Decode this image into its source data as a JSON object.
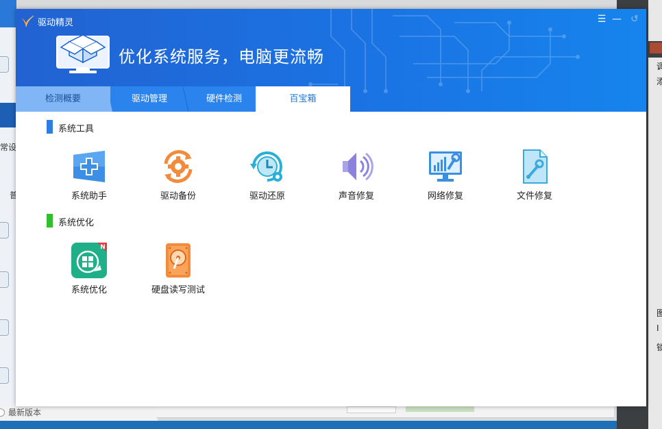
{
  "app": {
    "title": "驱动精灵",
    "banner_text": "优化系统服务，电脑更流畅"
  },
  "window_controls": {
    "menu_glyph": "☰",
    "minimize_glyph": "—",
    "restore_glyph": "↺"
  },
  "tabs": [
    {
      "label": "检测概要",
      "active": false
    },
    {
      "label": "驱动管理",
      "active": false
    },
    {
      "label": "硬件检测",
      "active": false
    },
    {
      "label": "百宝箱",
      "active": true
    }
  ],
  "sections": {
    "system_tools": {
      "label": "系统工具",
      "color": "#2e7de1",
      "items": [
        {
          "label": "系统助手",
          "icon": "windows-plus-icon"
        },
        {
          "label": "驱动备份",
          "icon": "gear-backup-icon"
        },
        {
          "label": "驱动还原",
          "icon": "clock-restore-icon"
        },
        {
          "label": "声音修复",
          "icon": "speaker-icon"
        },
        {
          "label": "网络修复",
          "icon": "monitor-wrench-icon"
        },
        {
          "label": "文件修复",
          "icon": "file-wrench-icon"
        }
      ]
    },
    "system_optimize": {
      "label": "系统优化",
      "color": "#2fbf2f",
      "items": [
        {
          "label": "系统优化",
          "icon": "rocket-windows-icon",
          "badge": "N"
        },
        {
          "label": "硬盘读写测试",
          "icon": "hard-disk-icon"
        }
      ]
    }
  },
  "background": {
    "left_fragment_1": "常设",
    "left_fragment_2": "普",
    "footer_text": "最新版本",
    "right_fragment_1": "调",
    "right_fragment_2": "添",
    "right_fragment_3": "图",
    "right_fragment_4": "I",
    "right_fragment_5": "锁"
  },
  "colors": {
    "header_start": "#2262d2",
    "header_end": "#1684ec",
    "tab_active_text": "#1d77d9",
    "badge": "#e8393b"
  }
}
